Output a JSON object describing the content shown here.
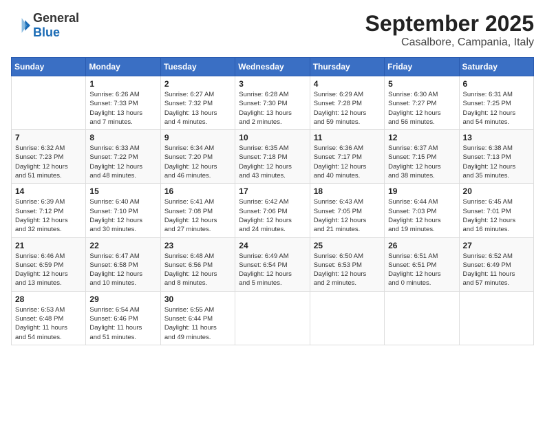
{
  "logo": {
    "general": "General",
    "blue": "Blue"
  },
  "header": {
    "month": "September 2025",
    "location": "Casalbore, Campania, Italy"
  },
  "days_of_week": [
    "Sunday",
    "Monday",
    "Tuesday",
    "Wednesday",
    "Thursday",
    "Friday",
    "Saturday"
  ],
  "weeks": [
    [
      {
        "day": "",
        "info": ""
      },
      {
        "day": "1",
        "info": "Sunrise: 6:26 AM\nSunset: 7:33 PM\nDaylight: 13 hours\nand 7 minutes."
      },
      {
        "day": "2",
        "info": "Sunrise: 6:27 AM\nSunset: 7:32 PM\nDaylight: 13 hours\nand 4 minutes."
      },
      {
        "day": "3",
        "info": "Sunrise: 6:28 AM\nSunset: 7:30 PM\nDaylight: 13 hours\nand 2 minutes."
      },
      {
        "day": "4",
        "info": "Sunrise: 6:29 AM\nSunset: 7:28 PM\nDaylight: 12 hours\nand 59 minutes."
      },
      {
        "day": "5",
        "info": "Sunrise: 6:30 AM\nSunset: 7:27 PM\nDaylight: 12 hours\nand 56 minutes."
      },
      {
        "day": "6",
        "info": "Sunrise: 6:31 AM\nSunset: 7:25 PM\nDaylight: 12 hours\nand 54 minutes."
      }
    ],
    [
      {
        "day": "7",
        "info": "Sunrise: 6:32 AM\nSunset: 7:23 PM\nDaylight: 12 hours\nand 51 minutes."
      },
      {
        "day": "8",
        "info": "Sunrise: 6:33 AM\nSunset: 7:22 PM\nDaylight: 12 hours\nand 48 minutes."
      },
      {
        "day": "9",
        "info": "Sunrise: 6:34 AM\nSunset: 7:20 PM\nDaylight: 12 hours\nand 46 minutes."
      },
      {
        "day": "10",
        "info": "Sunrise: 6:35 AM\nSunset: 7:18 PM\nDaylight: 12 hours\nand 43 minutes."
      },
      {
        "day": "11",
        "info": "Sunrise: 6:36 AM\nSunset: 7:17 PM\nDaylight: 12 hours\nand 40 minutes."
      },
      {
        "day": "12",
        "info": "Sunrise: 6:37 AM\nSunset: 7:15 PM\nDaylight: 12 hours\nand 38 minutes."
      },
      {
        "day": "13",
        "info": "Sunrise: 6:38 AM\nSunset: 7:13 PM\nDaylight: 12 hours\nand 35 minutes."
      }
    ],
    [
      {
        "day": "14",
        "info": "Sunrise: 6:39 AM\nSunset: 7:12 PM\nDaylight: 12 hours\nand 32 minutes."
      },
      {
        "day": "15",
        "info": "Sunrise: 6:40 AM\nSunset: 7:10 PM\nDaylight: 12 hours\nand 30 minutes."
      },
      {
        "day": "16",
        "info": "Sunrise: 6:41 AM\nSunset: 7:08 PM\nDaylight: 12 hours\nand 27 minutes."
      },
      {
        "day": "17",
        "info": "Sunrise: 6:42 AM\nSunset: 7:06 PM\nDaylight: 12 hours\nand 24 minutes."
      },
      {
        "day": "18",
        "info": "Sunrise: 6:43 AM\nSunset: 7:05 PM\nDaylight: 12 hours\nand 21 minutes."
      },
      {
        "day": "19",
        "info": "Sunrise: 6:44 AM\nSunset: 7:03 PM\nDaylight: 12 hours\nand 19 minutes."
      },
      {
        "day": "20",
        "info": "Sunrise: 6:45 AM\nSunset: 7:01 PM\nDaylight: 12 hours\nand 16 minutes."
      }
    ],
    [
      {
        "day": "21",
        "info": "Sunrise: 6:46 AM\nSunset: 6:59 PM\nDaylight: 12 hours\nand 13 minutes."
      },
      {
        "day": "22",
        "info": "Sunrise: 6:47 AM\nSunset: 6:58 PM\nDaylight: 12 hours\nand 10 minutes."
      },
      {
        "day": "23",
        "info": "Sunrise: 6:48 AM\nSunset: 6:56 PM\nDaylight: 12 hours\nand 8 minutes."
      },
      {
        "day": "24",
        "info": "Sunrise: 6:49 AM\nSunset: 6:54 PM\nDaylight: 12 hours\nand 5 minutes."
      },
      {
        "day": "25",
        "info": "Sunrise: 6:50 AM\nSunset: 6:53 PM\nDaylight: 12 hours\nand 2 minutes."
      },
      {
        "day": "26",
        "info": "Sunrise: 6:51 AM\nSunset: 6:51 PM\nDaylight: 12 hours\nand 0 minutes."
      },
      {
        "day": "27",
        "info": "Sunrise: 6:52 AM\nSunset: 6:49 PM\nDaylight: 11 hours\nand 57 minutes."
      }
    ],
    [
      {
        "day": "28",
        "info": "Sunrise: 6:53 AM\nSunset: 6:48 PM\nDaylight: 11 hours\nand 54 minutes."
      },
      {
        "day": "29",
        "info": "Sunrise: 6:54 AM\nSunset: 6:46 PM\nDaylight: 11 hours\nand 51 minutes."
      },
      {
        "day": "30",
        "info": "Sunrise: 6:55 AM\nSunset: 6:44 PM\nDaylight: 11 hours\nand 49 minutes."
      },
      {
        "day": "",
        "info": ""
      },
      {
        "day": "",
        "info": ""
      },
      {
        "day": "",
        "info": ""
      },
      {
        "day": "",
        "info": ""
      }
    ]
  ]
}
